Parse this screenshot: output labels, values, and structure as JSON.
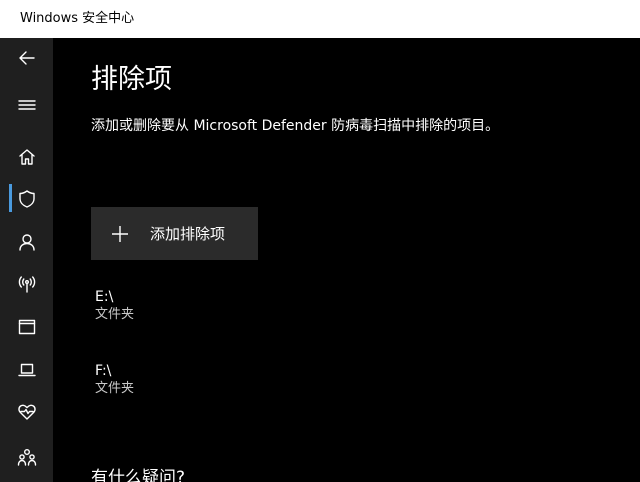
{
  "window": {
    "title": "Windows 安全中心"
  },
  "sidebar": {
    "items": [
      {
        "name": "back",
        "icon": "back-arrow-icon"
      },
      {
        "name": "menu",
        "icon": "hamburger-menu-icon"
      },
      {
        "name": "home",
        "icon": "home-icon"
      },
      {
        "name": "virus-protection",
        "icon": "shield-icon",
        "active": true
      },
      {
        "name": "account",
        "icon": "person-icon"
      },
      {
        "name": "firewall",
        "icon": "wireless-antenna-icon"
      },
      {
        "name": "app-browser",
        "icon": "browser-window-icon"
      },
      {
        "name": "device-security",
        "icon": "laptop-icon"
      },
      {
        "name": "device-health",
        "icon": "heart-pulse-icon"
      },
      {
        "name": "family",
        "icon": "family-group-icon"
      }
    ]
  },
  "main": {
    "title": "排除项",
    "description": "添加或删除要从 Microsoft Defender 防病毒扫描中排除的项目。",
    "add_button_label": "添加排除项",
    "exclusions": [
      {
        "path": "E:\\",
        "type": "文件夹"
      },
      {
        "path": "F:\\",
        "type": "文件夹"
      }
    ],
    "help_heading": "有什么疑问?"
  },
  "colors": {
    "background": "#000000",
    "sidebar": "#1f1f1f",
    "titlebar": "#ffffff",
    "button": "#2b2b2b",
    "accent": "#4a9ade",
    "text": "#ffffff",
    "secondary_text": "#c8c8c8"
  }
}
